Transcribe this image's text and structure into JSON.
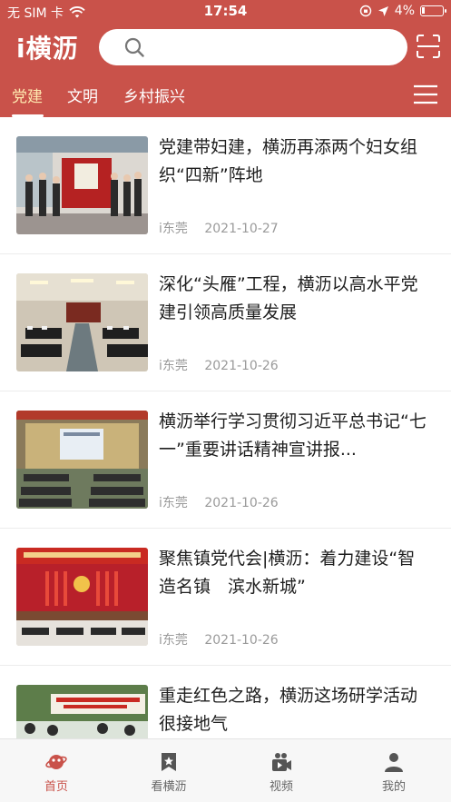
{
  "status_bar": {
    "carrier": "无 SIM 卡",
    "time": "17:54",
    "battery": "4%"
  },
  "app": {
    "logo": "i横沥",
    "search_placeholder": ""
  },
  "tabs": [
    {
      "label": "党建",
      "active": true
    },
    {
      "label": "文明",
      "active": false
    },
    {
      "label": "乡村振兴",
      "active": false
    }
  ],
  "news": [
    {
      "title": "党建带妇建，横沥再添两个妇女组织“四新”阵地",
      "source": "i东莞",
      "date": "2021-10-27",
      "image": "ribbon-ceremony-photo"
    },
    {
      "title": "深化“头雁”工程，横沥以高水平党建引领高质量发展",
      "source": "i东莞",
      "date": "2021-10-26",
      "image": "conference-room-photo"
    },
    {
      "title": "横沥举行学习贯彻习近平总书记“七一”重要讲话精神宣讲报...",
      "source": "i东莞",
      "date": "2021-10-26",
      "image": "lecture-hall-photo"
    },
    {
      "title": "聚焦镇党代会|横沥：着力建设“智造名镇　滨水新城”",
      "source": "i东莞",
      "date": "2021-10-26",
      "image": "party-congress-photo"
    },
    {
      "title": "重走红色之路，横沥这场研学活动很接地气",
      "source": "",
      "date": "",
      "image": "study-tour-photo"
    }
  ],
  "bottom_nav": [
    {
      "label": "首页",
      "icon": "planet-icon",
      "active": true
    },
    {
      "label": "看横沥",
      "icon": "star-bookmark-icon",
      "active": false
    },
    {
      "label": "视频",
      "icon": "video-icon",
      "active": false
    },
    {
      "label": "我的",
      "icon": "user-icon",
      "active": false
    }
  ],
  "colors": {
    "brand": "#c9524a",
    "active_tab": "#ffe9b0"
  }
}
